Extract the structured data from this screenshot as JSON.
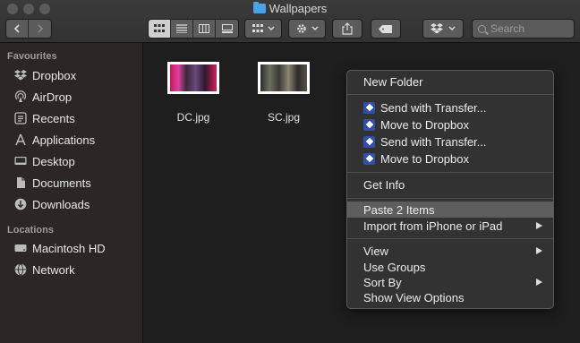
{
  "window": {
    "title": "Wallpapers"
  },
  "toolbar": {
    "search_placeholder": "Search"
  },
  "sidebar": {
    "favourites_heading": "Favourites",
    "favourites": [
      {
        "label": "Dropbox",
        "icon": "dropbox-icon"
      },
      {
        "label": "AirDrop",
        "icon": "airdrop-icon"
      },
      {
        "label": "Recents",
        "icon": "recents-icon"
      },
      {
        "label": "Applications",
        "icon": "applications-icon"
      },
      {
        "label": "Desktop",
        "icon": "desktop-icon"
      },
      {
        "label": "Documents",
        "icon": "documents-icon"
      },
      {
        "label": "Downloads",
        "icon": "downloads-icon"
      }
    ],
    "locations_heading": "Locations",
    "locations": [
      {
        "label": "Macintosh HD",
        "icon": "disk-icon"
      },
      {
        "label": "Network",
        "icon": "network-icon"
      }
    ]
  },
  "files": [
    {
      "name": "DC.jpg"
    },
    {
      "name": "SC.jpg"
    }
  ],
  "context_menu": {
    "new_folder": "New Folder",
    "dropbox_items": [
      "Send with Transfer...",
      "Move to Dropbox",
      "Send with Transfer...",
      "Move to Dropbox"
    ],
    "get_info": "Get Info",
    "paste": "Paste 2 Items",
    "import": "Import from iPhone or iPad",
    "view": "View",
    "use_groups": "Use Groups",
    "sort_by": "Sort By",
    "show_view_options": "Show View Options"
  },
  "colors": {
    "sidebar_bg": "#2b2726",
    "menu_bg": "#323232",
    "highlight": "#5d5d5d",
    "dropbox_blue": "#2f4fa8"
  }
}
